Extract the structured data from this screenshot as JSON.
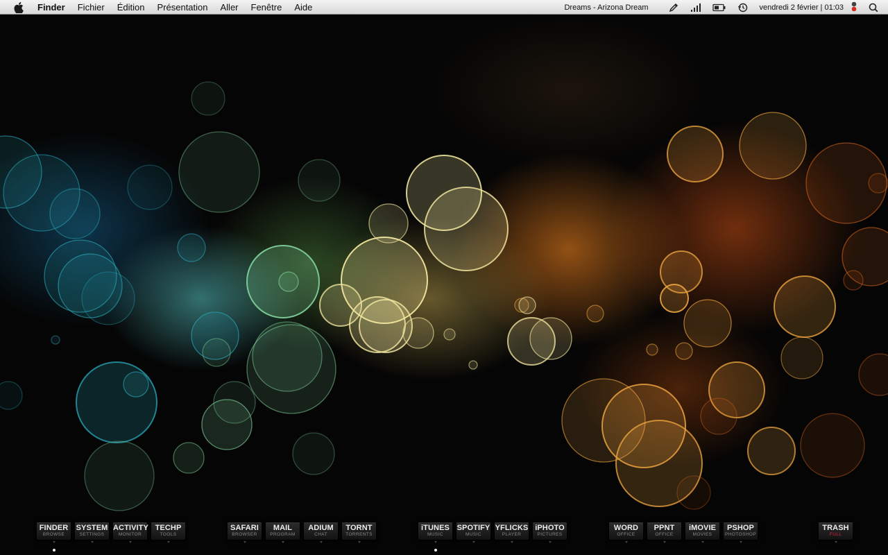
{
  "menubar": {
    "apple_icon": "apple-icon",
    "app_name": "Finder",
    "menus": [
      "Fichier",
      "Édition",
      "Présentation",
      "Aller",
      "Fenêtre",
      "Aide"
    ],
    "now_playing": "Dreams - Arizona Dream",
    "status_icons": [
      "pencil-icon",
      "signal-bars-icon",
      "battery-icon",
      "time-machine-icon"
    ],
    "clock": "vendredi 2 février | 01:03",
    "trailing_icons": [
      "traffic-light-icon",
      "spotlight-icon"
    ]
  },
  "dock": {
    "groups": [
      [
        {
          "name": "FINDER",
          "sub": "BROWSE",
          "running": true
        },
        {
          "name": "SYSTEM",
          "sub": "SETTINGS"
        },
        {
          "name": "ACTIVITY",
          "sub": "MONITOR"
        },
        {
          "name": "TECHP",
          "sub": "TOOLS"
        }
      ],
      [
        {
          "name": "SAFARI",
          "sub": "BROWSER"
        },
        {
          "name": "MAIL",
          "sub": "PROGRAM"
        },
        {
          "name": "ADIUM",
          "sub": "CHAT"
        },
        {
          "name": "TORNT",
          "sub": "TORRENTS"
        }
      ],
      [
        {
          "name": "iTUNES",
          "sub": "MUSIC",
          "running": true
        },
        {
          "name": "SPOTIFY",
          "sub": "MUSIC"
        },
        {
          "name": "YFLICKS",
          "sub": "PLAYER"
        },
        {
          "name": "iPHOTO",
          "sub": "PICTURES"
        }
      ],
      [
        {
          "name": "WORD",
          "sub": "OFFICE"
        },
        {
          "name": "PPNT",
          "sub": "OFFICE"
        },
        {
          "name": "iMOVIE",
          "sub": "MOVIES"
        },
        {
          "name": "PSHOP",
          "sub": "PHOTOSHOP"
        }
      ],
      [
        {
          "name": "TRASH",
          "sub": "FULL",
          "sub_color": "#e0263b"
        }
      ]
    ]
  },
  "wallpaper": {
    "style": "bokeh",
    "palette": [
      "#2aa6b8",
      "#7fcf9a",
      "#f3e7a0",
      "#f0a640",
      "#d8641c"
    ]
  }
}
